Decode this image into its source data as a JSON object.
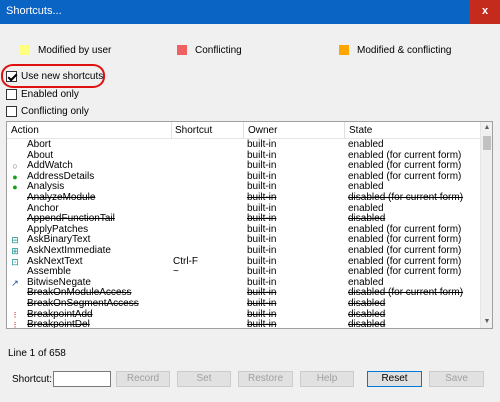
{
  "window": {
    "title": "Shortcuts...",
    "close_glyph": "x"
  },
  "legend": [
    {
      "label": "Modified by user",
      "color": "#ffff80"
    },
    {
      "label": "Conflicting",
      "color": "#f06060"
    },
    {
      "label": "Modified & conflicting",
      "color": "#ffa500"
    }
  ],
  "options": {
    "use_new_shortcuts": {
      "label": "Use new shortcuts",
      "checked": true
    },
    "enabled_only": {
      "label": "Enabled only",
      "checked": false
    },
    "conflicting_only": {
      "label": "Conflicting only",
      "checked": false
    }
  },
  "table": {
    "columns": [
      "Action",
      "Shortcut",
      "Owner",
      "State"
    ],
    "rows": [
      {
        "icon": "",
        "action": "Abort",
        "shortcut": "",
        "owner": "built-in",
        "state": "enabled",
        "strike": false
      },
      {
        "icon": "",
        "action": "About",
        "shortcut": "",
        "owner": "built-in",
        "state": "enabled (for current form)",
        "strike": false
      },
      {
        "icon": "watch-icon",
        "action": "AddWatch",
        "shortcut": "",
        "owner": "built-in",
        "state": "enabled (for current form)",
        "strike": false
      },
      {
        "icon": "address-icon",
        "action": "AddressDetails",
        "shortcut": "",
        "owner": "built-in",
        "state": "enabled (for current form)",
        "strike": false
      },
      {
        "icon": "analysis-icon",
        "action": "Analysis",
        "shortcut": "",
        "owner": "built-in",
        "state": "enabled",
        "strike": false
      },
      {
        "icon": "",
        "action": "AnalyzeModule",
        "shortcut": "",
        "owner": "built-in",
        "state": "disabled (for current form)",
        "strike": true
      },
      {
        "icon": "",
        "action": "Anchor",
        "shortcut": "",
        "owner": "built-in",
        "state": "enabled",
        "strike": false
      },
      {
        "icon": "",
        "action": "AppendFunctionTail",
        "shortcut": "",
        "owner": "built-in",
        "state": "disabled",
        "strike": true
      },
      {
        "icon": "",
        "action": "ApplyPatches",
        "shortcut": "",
        "owner": "built-in",
        "state": "enabled (for current form)",
        "strike": false
      },
      {
        "icon": "binary-text-icon",
        "action": "AskBinaryText",
        "shortcut": "",
        "owner": "built-in",
        "state": "enabled (for current form)",
        "strike": false
      },
      {
        "icon": "next-immediate-icon",
        "action": "AskNextImmediate",
        "shortcut": "",
        "owner": "built-in",
        "state": "enabled (for current form)",
        "strike": false
      },
      {
        "icon": "next-text-icon",
        "action": "AskNextText",
        "shortcut": "Ctrl-F",
        "owner": "built-in",
        "state": "enabled (for current form)",
        "strike": false
      },
      {
        "icon": "",
        "action": "Assemble",
        "shortcut": "~",
        "owner": "built-in",
        "state": "enabled (for current form)",
        "strike": false
      },
      {
        "icon": "bitwise-negate-icon",
        "action": "BitwiseNegate",
        "shortcut": "",
        "owner": "built-in",
        "state": "enabled",
        "strike": false
      },
      {
        "icon": "",
        "action": "BreakOnModuleAccess",
        "shortcut": "",
        "owner": "built-in",
        "state": "disabled (for current form)",
        "strike": true
      },
      {
        "icon": "",
        "action": "BreakOnSegmentAccess",
        "shortcut": "",
        "owner": "built-in",
        "state": "disabled",
        "strike": true
      },
      {
        "icon": "breakpoint-add-icon",
        "action": "BreakpointAdd",
        "shortcut": "",
        "owner": "built-in",
        "state": "disabled",
        "strike": true
      },
      {
        "icon": "breakpoint-del-icon",
        "action": "BreakpointDel",
        "shortcut": "",
        "owner": "built-in",
        "state": "disabled",
        "strike": true
      }
    ]
  },
  "status": {
    "text": "Line 1 of 658"
  },
  "bottom_bar": {
    "shortcut_label": "Shortcut:",
    "shortcut_value": "",
    "record": "Record",
    "set": "Set",
    "restore": "Restore",
    "help": "Help",
    "reset": "Reset",
    "save": "Save"
  }
}
